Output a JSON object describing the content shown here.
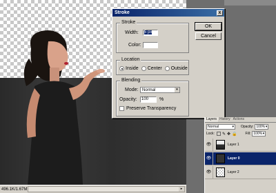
{
  "status_bar": {
    "size_text": "496.1K/1.67M"
  },
  "dialog": {
    "title": "Stroke",
    "close_label": "x",
    "stroke_group": {
      "label": "Stroke",
      "width_label": "Width:",
      "width_value": "5 px",
      "color_label": "Color:"
    },
    "location_group": {
      "label": "Location",
      "options": [
        "Inside",
        "Center",
        "Outside"
      ],
      "selected": "Inside"
    },
    "blending_group": {
      "label": "Blending",
      "mode_label": "Mode:",
      "mode_value": "Normal",
      "opacity_label": "Opacity:",
      "opacity_value": "100",
      "opacity_unit": "%",
      "preserve_label": "Preserve Transparency"
    },
    "ok_label": "OK",
    "cancel_label": "Cancel"
  },
  "layers_palette": {
    "tabs": [
      "Layers",
      "History",
      "Actions"
    ],
    "blend_mode": "Normal",
    "opacity_label": "Opacity:",
    "opacity_value": "100%",
    "lock_label": "Lock:",
    "fill_label": "Fill:",
    "fill_value": "100%",
    "layers": [
      {
        "name": "Layer 1",
        "selected": false
      },
      {
        "name": "Layer 0",
        "selected": true
      },
      {
        "name": "Layer 2",
        "selected": false
      }
    ]
  },
  "colors": {
    "title_bar": "#0a246a",
    "selection": "#0a246a",
    "dialog_bg": "#d4d0c8"
  }
}
